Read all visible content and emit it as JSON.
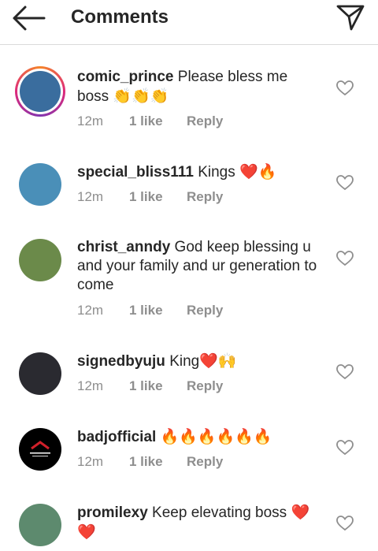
{
  "header": {
    "title": "Comments",
    "back_icon": "arrow-left-icon",
    "send_icon": "paper-plane-icon"
  },
  "comments": [
    {
      "username": "comic_prince",
      "text": "Please bless me boss",
      "emoji": "👏👏👏",
      "time": "12m",
      "likes": "1 like",
      "reply": "Reply",
      "avatar_color": "#3a6d9e"
    },
    {
      "username": "special_bliss111",
      "text": "Kings",
      "emoji": "❤️🔥",
      "time": "12m",
      "likes": "1 like",
      "reply": "Reply",
      "avatar_color": "#4a8fb8"
    },
    {
      "username": "christ_anndy",
      "text": "God keep blessing u and your family and ur generation to come",
      "emoji": "",
      "time": "12m",
      "likes": "1 like",
      "reply": "Reply",
      "avatar_color": "#6b8a4a"
    },
    {
      "username": "signedbyuju",
      "text": "King",
      "emoji": "❤️🙌",
      "time": "12m",
      "likes": "1 like",
      "reply": "Reply",
      "avatar_color": "#2a2a30"
    },
    {
      "username": "badjofficial",
      "text": "",
      "emoji": "🔥🔥🔥🔥🔥🔥",
      "time": "12m",
      "likes": "1 like",
      "reply": "Reply",
      "avatar_color": "#000000"
    },
    {
      "username": "promilexy",
      "text": "Keep elevating boss",
      "emoji": "❤️❤️",
      "time": "",
      "likes": "",
      "reply": "",
      "avatar_color": "#5d8a6e"
    }
  ]
}
